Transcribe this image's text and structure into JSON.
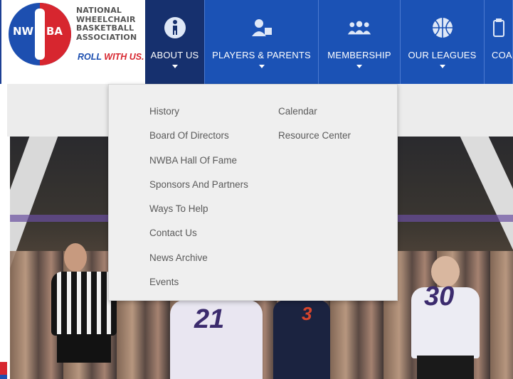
{
  "brand": {
    "logo_left": "NW",
    "logo_right": "BA",
    "org_name_lines": [
      "NATIONAL",
      "WHEELCHAIR",
      "BASKETBALL",
      "ASSOCIATION"
    ],
    "tagline_part1": "ROLL ",
    "tagline_part2": "WITH US."
  },
  "nav": {
    "items": [
      {
        "label": "ABOUT US",
        "icon": "basketball-player-icon",
        "active": true
      },
      {
        "label": "PLAYERS & PARENTS",
        "icon": "player-parent-icon"
      },
      {
        "label": "MEMBERSHIP",
        "icon": "group-members-icon"
      },
      {
        "label": "OUR LEAGUES",
        "icon": "basketball-icon"
      },
      {
        "label": "COA",
        "icon": "clipboard-icon"
      }
    ]
  },
  "dropdown": {
    "column1": [
      "History",
      "Board Of Directors",
      "NWBA Hall Of Fame",
      "Sponsors And Partners",
      "Ways To Help",
      "Contact Us",
      "News Archive",
      "Events"
    ],
    "column2": [
      "Calendar",
      "Resource Center"
    ]
  },
  "photo": {
    "jersey_numbers": [
      "21",
      "3",
      "30"
    ]
  },
  "colors": {
    "nav_blue": "#1b52b5",
    "nav_active": "#16306e",
    "brand_red": "#d7262f",
    "brand_blue": "#1d4fb0",
    "dropdown_bg": "#efefef"
  }
}
